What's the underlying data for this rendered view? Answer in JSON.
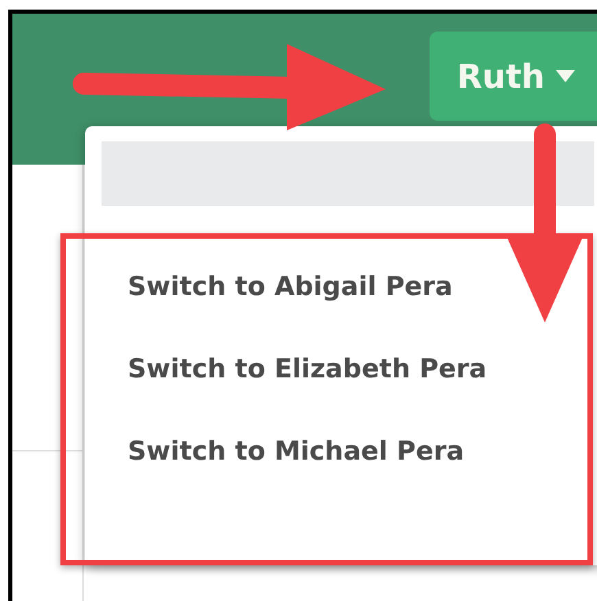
{
  "header": {
    "user_button": {
      "label": "Ruth"
    }
  },
  "menu": {
    "items": [
      {
        "label": "Switch to Abigail Pera"
      },
      {
        "label": "Switch to Elizabeth Pera"
      },
      {
        "label": "Switch to Michael Pera"
      }
    ]
  }
}
